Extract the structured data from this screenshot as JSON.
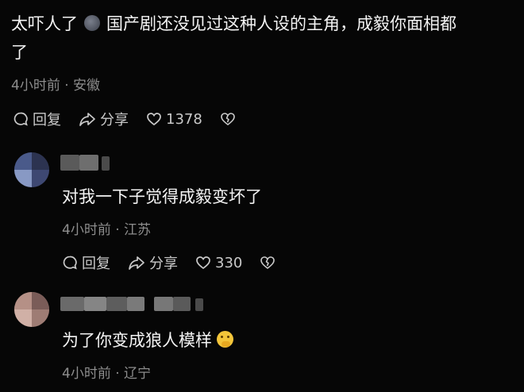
{
  "post": {
    "text": "太吓人了🌚 国产剧还没见过这种人设的主角，成毅你面相都了",
    "text_line1": "太吓人了",
    "text_line1_rest": "国产剧还没见过这种人设的主角，成毅你面相都",
    "text_line2": "了",
    "meta": "4小时前 · 安徽",
    "reply_label": "回复",
    "share_label": "分享",
    "like_count": "1378"
  },
  "replies": [
    {
      "text": "对我一下子觉得成毅变坏了",
      "meta": "4小时前 · 江苏",
      "reply_label": "回复",
      "share_label": "分享",
      "like_count": "330"
    },
    {
      "text": "为了你变成狼人模样",
      "meta": "4小时前 · 辽宁"
    }
  ],
  "icons": {
    "reply": "comment-bubble-icon",
    "share": "share-arrow-icon",
    "like": "heart-icon",
    "dislike": "broken-heart-icon",
    "moon_emoji": "new-moon-face-emoji",
    "face_emoji": "face-with-hand-over-mouth-emoji"
  },
  "colors": {
    "background": "#060606",
    "text": "#f4f4f4",
    "meta": "#8d8d8d",
    "action": "#c9c9c9"
  }
}
